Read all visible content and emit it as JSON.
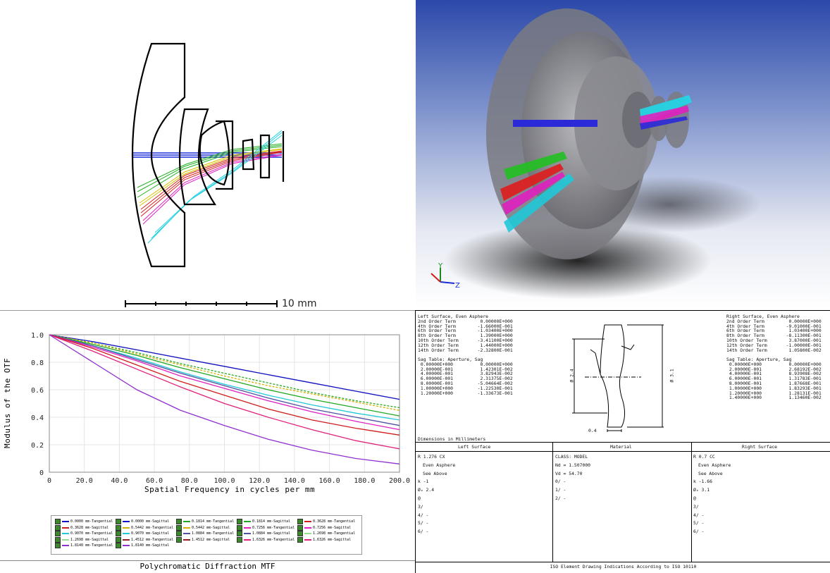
{
  "layout_panel": {
    "scale_label": "10 mm"
  },
  "view3d_panel": {
    "axis_labels": {
      "y": "Y",
      "z": "Z"
    }
  },
  "mtf": {
    "title": "Polychromatic Diffraction MTF",
    "ylabel": "Modulus of the OTF",
    "xlabel": "Spatial Frequency in cycles per mm",
    "xticks": [
      "0",
      "20.0",
      "40.0",
      "60.0",
      "80.0",
      "100.0",
      "120.0",
      "140.0",
      "160.0",
      "180.0",
      "200.0"
    ],
    "yticks": [
      "0",
      "0.2",
      "0.4",
      "0.6",
      "0.8",
      "1.0"
    ],
    "legend": [
      {
        "label": "0.0000 mm-Tangential",
        "color": "#1010c0",
        "dash": false
      },
      {
        "label": "0.0000 mm-Sagittal",
        "color": "#1010c0",
        "dash": true
      },
      {
        "label": "0.1814 mm-Tangential",
        "color": "#22a822",
        "dash": false
      },
      {
        "label": "0.1814 mm-Sagittal",
        "color": "#22a822",
        "dash": true
      },
      {
        "label": "0.3628 mm-Tangential",
        "color": "#d01c1c",
        "dash": false
      },
      {
        "label": "0.3628 mm-Sagittal",
        "color": "#d01c1c",
        "dash": true
      },
      {
        "label": "0.5442 mm-Tangential",
        "color": "#d4b000",
        "dash": false
      },
      {
        "label": "0.5442 mm-Sagittal",
        "color": "#d4b000",
        "dash": true
      },
      {
        "label": "0.7256 mm-Tangential",
        "color": "#e020c0",
        "dash": false
      },
      {
        "label": "0.7256 mm-Sagittal",
        "color": "#e020c0",
        "dash": true
      },
      {
        "label": "0.9070 mm-Tangential",
        "color": "#20c8d8",
        "dash": false
      },
      {
        "label": "0.9070 mm-Sagittal",
        "color": "#20c8d8",
        "dash": true
      },
      {
        "label": "1.0884 mm-Tangential",
        "color": "#5050a0",
        "dash": false
      },
      {
        "label": "1.0884 mm-Sagittal",
        "color": "#5050a0",
        "dash": true
      },
      {
        "label": "1.2698 mm-Tangential",
        "color": "#90e090",
        "dash": false
      },
      {
        "label": "1.2698 mm-Sagittal",
        "color": "#90e090",
        "dash": true
      },
      {
        "label": "1.4512 mm-Tangential",
        "color": "#902020",
        "dash": false
      },
      {
        "label": "1.4512 mm-Sagittal",
        "color": "#902020",
        "dash": true
      },
      {
        "label": "1.6326 mm-Tangential",
        "color": "#e0207a",
        "dash": false
      },
      {
        "label": "1.6326 mm-Sagittal",
        "color": "#e0207a",
        "dash": true
      },
      {
        "label": "1.8140 mm-Tangential",
        "color": "#9030d0",
        "dash": false
      },
      {
        "label": "1.8140 mm-Sagittal",
        "color": "#9030d0",
        "dash": true
      }
    ]
  },
  "chart_data": {
    "type": "line",
    "title": "Polychromatic Diffraction MTF",
    "xlabel": "Spatial Frequency in cycles per mm",
    "ylabel": "Modulus of the OTF",
    "xlim": [
      0,
      200
    ],
    "ylim": [
      0,
      1.0
    ],
    "grid": true,
    "legend_position": "bottom",
    "x": [
      0,
      25,
      50,
      75,
      100,
      125,
      150,
      175,
      200
    ],
    "series": [
      {
        "name": "0.0000 mm-Tangential",
        "color": "#1010c0",
        "dash": false,
        "values": [
          1.0,
          0.95,
          0.89,
          0.83,
          0.77,
          0.71,
          0.65,
          0.59,
          0.53
        ]
      },
      {
        "name": "0.1814 mm-Sagittal",
        "color": "#22a822",
        "dash": true,
        "values": [
          1.0,
          0.94,
          0.87,
          0.79,
          0.72,
          0.65,
          0.58,
          0.52,
          0.47
        ]
      },
      {
        "name": "0.5442 mm-Sagittal",
        "color": "#d4b000",
        "dash": true,
        "values": [
          1.0,
          0.94,
          0.86,
          0.78,
          0.7,
          0.63,
          0.57,
          0.51,
          0.45
        ]
      },
      {
        "name": "0.1814 mm-Tangential",
        "color": "#22a822",
        "dash": false,
        "values": [
          1.0,
          0.93,
          0.85,
          0.76,
          0.68,
          0.6,
          0.53,
          0.47,
          0.41
        ]
      },
      {
        "name": "0.9070 mm-Tangential",
        "color": "#20c8d8",
        "dash": false,
        "values": [
          1.0,
          0.92,
          0.83,
          0.73,
          0.64,
          0.56,
          0.49,
          0.43,
          0.38
        ]
      },
      {
        "name": "1.0884 mm-Tangential",
        "color": "#5050a0",
        "dash": false,
        "values": [
          1.0,
          0.92,
          0.82,
          0.72,
          0.63,
          0.54,
          0.46,
          0.4,
          0.34
        ]
      },
      {
        "name": "0.7256 mm-Tangential",
        "color": "#e020c0",
        "dash": false,
        "values": [
          1.0,
          0.91,
          0.81,
          0.7,
          0.61,
          0.52,
          0.44,
          0.37,
          0.31
        ]
      },
      {
        "name": "0.3628 mm-Tangential",
        "color": "#d01c1c",
        "dash": false,
        "values": [
          1.0,
          0.9,
          0.78,
          0.66,
          0.56,
          0.46,
          0.38,
          0.32,
          0.27
        ]
      },
      {
        "name": "1.6326 mm-Tangential",
        "color": "#e0207a",
        "dash": false,
        "values": [
          1.0,
          0.88,
          0.75,
          0.62,
          0.5,
          0.4,
          0.31,
          0.23,
          0.17
        ]
      },
      {
        "name": "1.8140 mm-Tangential",
        "color": "#9030d0",
        "dash": false,
        "values": [
          1.0,
          0.8,
          0.6,
          0.45,
          0.34,
          0.24,
          0.16,
          0.1,
          0.06
        ]
      }
    ]
  },
  "iso": {
    "left_surface_block": "Left Surface, Even Asphere\n2nd Order Term         0.00000E+000\n4th Order Term        -1.66000E-001\n6th Order Term        -1.03400E+000\n8th Order Term         1.39000E+000\n10th Order Term       -3.41100E+000\n12th Order Term        1.44000E+000\n14th Order Term       -2.32800E-001",
    "left_sag_block": "Sag Table: Aperture, Sag\n 0.00000E+000          0.00000E+000\n 2.00000E-001          1.42301E-002\n 4.00000E-001          3.82943E-002\n 6.00000E-001          2.31375E-002\n 8.00000E-001         -5.04664E-002\n 1.00000E+000         -1.22530E-001\n 1.20000E+000         -1.33673E-001",
    "right_surface_block": "Right Surface, Even Asphere\n2nd Order Term         0.00000E+000\n4th Order Term        -9.01000E-001\n6th Order Term         1.03400E+000\n8th Order Term        -8.11300E-001\n10th Order Term        3.87000E-001\n12th Order Term       -1.00000E-001\n14th Order Term        1.05800E-002",
    "right_sag_block": "Sag Table: Aperture, Sag\n 0.00000E+000          0.00000E+000\n 2.00000E-001          2.68192E-002\n 4.00000E-001          8.93908E-002\n 6.00000E-001          1.31783E-001\n 8.00000E-001          1.87668E-001\n 1.00000E+000          1.83293E-001\n 1.20000E+000          1.28131E-001\n 1.40000E+000          1.13460E-002",
    "dim_label_left": "Ø 2.4",
    "dim_label_right": "Ø 3.1",
    "dim_label_bottom": "0.4",
    "dimensions_title": "Dimensions in Millimeters",
    "col_left": "Left Surface",
    "col_material": "Material",
    "col_right": "Right Surface",
    "left_rows": [
      "R 1.276  CX",
      "Even Asphere",
      "See Above",
      "k -1",
      "Øₑ 2.4",
      "@",
      "3/",
      "4/ -",
      "5/ -",
      "6/ -"
    ],
    "material_rows": [
      "CLASS: MODEL",
      "Nd = 1.507000",
      "Vd = 54.70",
      "0/ -",
      "1/ -",
      "2/ -"
    ],
    "right_rows": [
      "R 0.7  CC",
      "Even Asphere",
      "See Above",
      "k -1.66",
      "Øₑ 3.1",
      "@",
      "3/",
      "4/ -",
      "5/ -",
      "6/ -"
    ],
    "footer": "ISO Element Drawing Indications According to ISO 10110"
  }
}
